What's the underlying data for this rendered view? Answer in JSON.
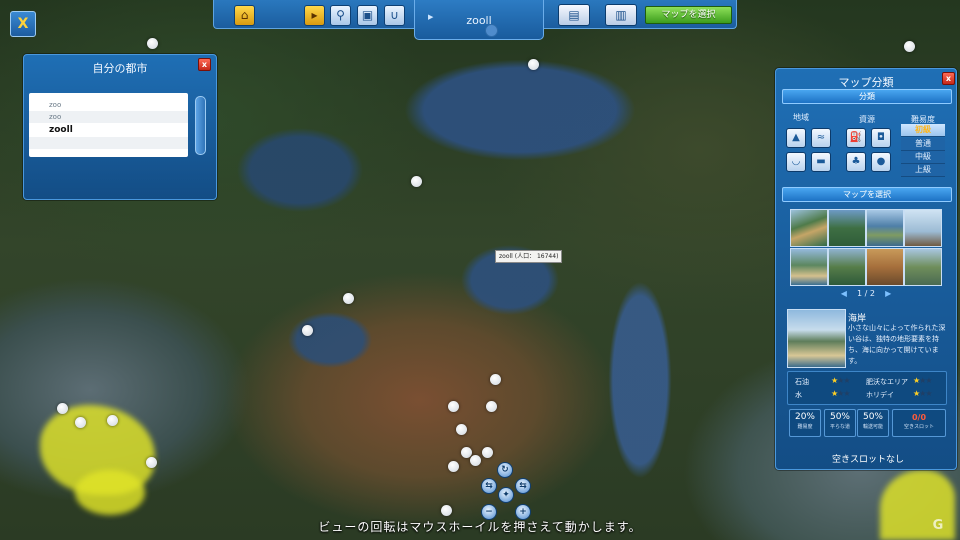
{
  "top_toolbar": {
    "city_name": "zooll",
    "select_map_label": "マップを選択"
  },
  "my_cities_panel": {
    "title": "自分の都市",
    "cities": [
      "zoo",
      "zoo",
      "zooll"
    ]
  },
  "map_filter_panel": {
    "title": "マップ分類",
    "category_header": "分類",
    "region_label": "地域",
    "resource_label": "資源",
    "difficulty_label": "難易度",
    "difficulty_options": [
      "初級",
      "普通",
      "中級",
      "上級"
    ],
    "selected_difficulty": "初級",
    "select_map_header": "マップを選択",
    "page_indicator": "1 / 2",
    "selected_map": {
      "title": "海岸",
      "description": "小さな山々によって作られた深い谷は、独特の地形要素を持ち、海に向かって開けています。"
    },
    "resources": [
      {
        "label": "石油",
        "stars": 1
      },
      {
        "label": "水",
        "stars": 1
      }
    ],
    "features": [
      {
        "label": "肥沃なエリア",
        "stars": 1
      },
      {
        "label": "ホリデイ",
        "stars": 1
      }
    ],
    "percentages": [
      {
        "value": "20%",
        "label": "難易度"
      },
      {
        "value": "50%",
        "label": "平らな道"
      },
      {
        "value": "50%",
        "label": "輸送可能"
      }
    ],
    "slots": {
      "value": "0/0",
      "label": "空きスロット"
    },
    "no_slots_text": "空きスロットなし"
  },
  "map_tooltip": "zooll (人口： 16744)",
  "bottom_hint": "ビューの回転はマウスホーイルを押さえて動かします。",
  "watermark_glyph": "G",
  "colors": {
    "panel_blue": "#1f6fb5",
    "accent_green": "#3c9d1c",
    "star_gold": "#ffcf24",
    "highlight_yellow": "#e1e428"
  }
}
